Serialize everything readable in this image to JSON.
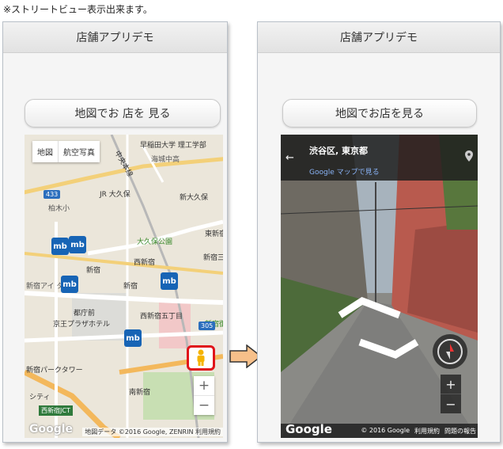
{
  "note": "※ストリートビュー表示出来ます。",
  "left_screen": {
    "header_title": "店舗アプリデモ",
    "cta_label": "地図でお 店を 見る",
    "map": {
      "type_buttons": [
        "地図",
        "航空写真"
      ],
      "labels": {
        "waseda": "早稲田大学 理工学部",
        "kaijo": "海城中高",
        "chuo": "中央本線",
        "jr_okubo": "JR 大久保",
        "shin_okubo": "新大久保",
        "kashiwagi": "柏木小",
        "okubo_park": "大久保公園",
        "higashi_shinjuku": "東新宿",
        "nishi_shinjuku": "西新宿",
        "nishishinjuku_tower": "新宿アイ タワー",
        "shinjuku_sanchome": "新宿三丁目",
        "tocho": "都庁前",
        "keio_plaza": "京王プラザホテル",
        "shinjuku_gyoen": "新宿御苑",
        "park_tower": "新宿パークタワー",
        "minami_shinjuku": "南新宿",
        "city": "シティ",
        "jct": "西新宿JCT",
        "shinjuku_left": "新宿",
        "shinjuku_mid": "新宿",
        "nishishinjuku_5": "西新宿五丁目"
      },
      "badge_433": "433",
      "badge_305": "305",
      "marker_label": "mb",
      "zoom_in": "+",
      "zoom_out": "−",
      "google": "Google",
      "attribution": "地図データ ©2016 Google, ZENRIN   利用規約"
    }
  },
  "right_screen": {
    "header_title": "店舗アプリデモ",
    "cta_label": "地図でお店を見る",
    "street_view": {
      "back": "←",
      "location": "渋谷区, 東京都",
      "map_link": "Google マップで見る",
      "zoom_in": "+",
      "zoom_out": "−",
      "google": "Google",
      "copyright": "© 2016 Google",
      "terms": "利用規約",
      "report": "問題の報告"
    }
  }
}
